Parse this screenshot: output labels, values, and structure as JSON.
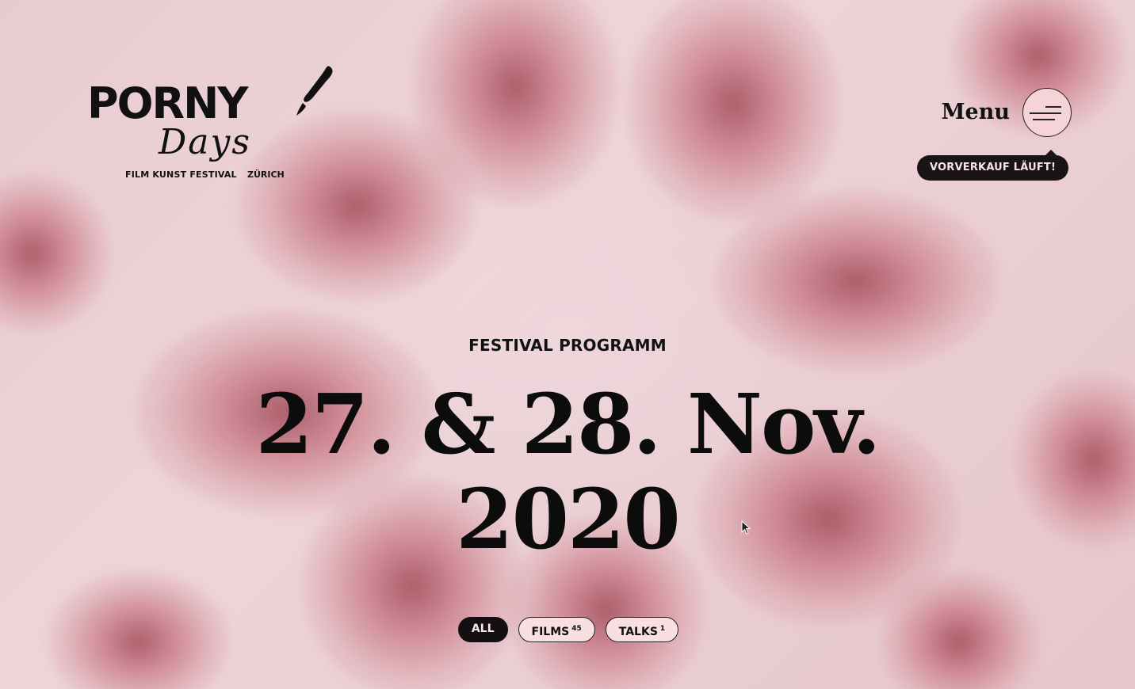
{
  "logo": {
    "wordmark": "PORNY",
    "script": "Days",
    "tagline_left": "FILM KUNST FESTIVAL",
    "tagline_right": "ZÜRICH"
  },
  "header": {
    "menu_label": "Menu",
    "presale_badge": "VORVERKAUF LÄUFT!"
  },
  "hero": {
    "eyebrow": "FESTIVAL PROGRAMM",
    "date_line_1": "27. & 28. Nov.",
    "date_line_2": "2020"
  },
  "filters": [
    {
      "label": "ALL",
      "count": "",
      "active": true
    },
    {
      "label": "FILMS",
      "count": "45",
      "active": false
    },
    {
      "label": "TALKS",
      "count": "1",
      "active": false
    }
  ],
  "colors": {
    "background": "#e9cdd0",
    "ink": "#111111",
    "badge_bg": "#1a1416",
    "pill_bg": "#f9dfe2",
    "menu_button_bg": "#f6d3d6"
  }
}
